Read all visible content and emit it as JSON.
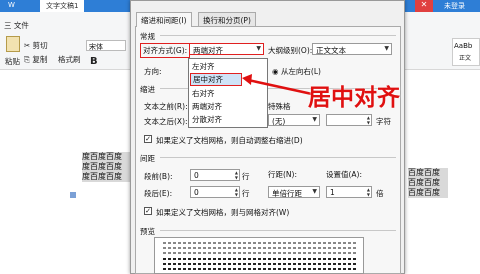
{
  "app": {
    "tab_wps": "W",
    "tab_doc": "文字文稿1",
    "file_menu": "三 文件",
    "cut": "剪切",
    "copy": "复制",
    "format_painter": "格式刷",
    "paste": "粘贴",
    "font_name": "宋体",
    "bold": "B",
    "style_sample": "AaBb",
    "style_label": "正文",
    "user_label": "未登录"
  },
  "document": {
    "lines": [
      "度百度百度",
      "度百度百度",
      "度百度百度"
    ],
    "right_lines": [
      "百度百度",
      "百度百度",
      "百度百度"
    ]
  },
  "dialog": {
    "tabs": [
      "缩进和间距(I)",
      "换行和分页(P)"
    ],
    "general": {
      "section": "常规",
      "align_label": "对齐方式(G):",
      "align_value": "两端对齐",
      "outline_label": "大纲级别(O):",
      "outline_value": "正文文本",
      "direction_label": "方向:",
      "direction_value": "从左向右(L)"
    },
    "dropdown": [
      "左对齐",
      "居中对齐",
      "右对齐",
      "两端对齐",
      "分散对齐"
    ],
    "indent": {
      "section": "缩进",
      "before_label": "文本之前(R):",
      "after_label": "文本之后(X):",
      "special_label": "特殊格",
      "special_value": "(无)",
      "unit": "字符",
      "grid_check": "如果定义了文档网格，则自动调整右缩进(D)"
    },
    "spacing": {
      "section": "间距",
      "before_label": "段前(B):",
      "before_value": "0",
      "after_label": "段后(E):",
      "after_value": "0",
      "unit": "行",
      "line_label": "行距(N):",
      "line_value": "单倍行距",
      "set_label": "设置值(A):",
      "set_value": "1",
      "set_unit": "倍",
      "grid_check": "如果定义了文档网格，则与网格对齐(W)"
    },
    "preview": {
      "section": "预览"
    }
  },
  "annotation": {
    "text": "居中对齐",
    "color": "#e01010"
  }
}
